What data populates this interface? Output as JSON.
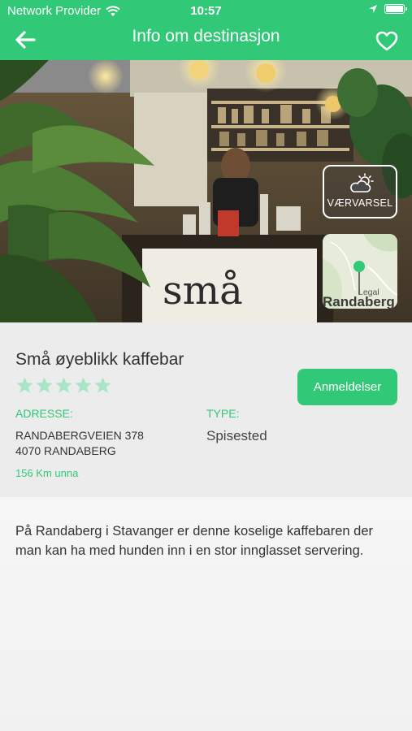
{
  "status_bar": {
    "carrier": "Network Provider",
    "time": "10:57"
  },
  "nav": {
    "title": "Info om destinasjon",
    "back_icon": "back-arrow-icon",
    "favorite_icon": "heart-outline-icon"
  },
  "hero": {
    "weather_label": "VÆRVARSEL",
    "map_legal": "Legal",
    "map_town": "Randaberg",
    "sign_text": "små øyeblikk"
  },
  "place": {
    "name": "Små øyeblikk kaffebar",
    "rating_stars": 5,
    "rating_filled": 0,
    "review_button": "Anmeldelser",
    "address_label": "ADRESSE:",
    "address_line1": "RANDABERGVEIEN 378",
    "address_line2": "4070 RANDABERG",
    "type_label": "TYPE:",
    "type_value": "Spisested",
    "distance": "156 Km unna"
  },
  "description": "På Randaberg i Stavanger er denne koselige kaffebaren der man kan ha med hunden inn i en stor innglasset servering.",
  "colors": {
    "accent": "#31c977",
    "star_empty": "#a8e6c6"
  }
}
